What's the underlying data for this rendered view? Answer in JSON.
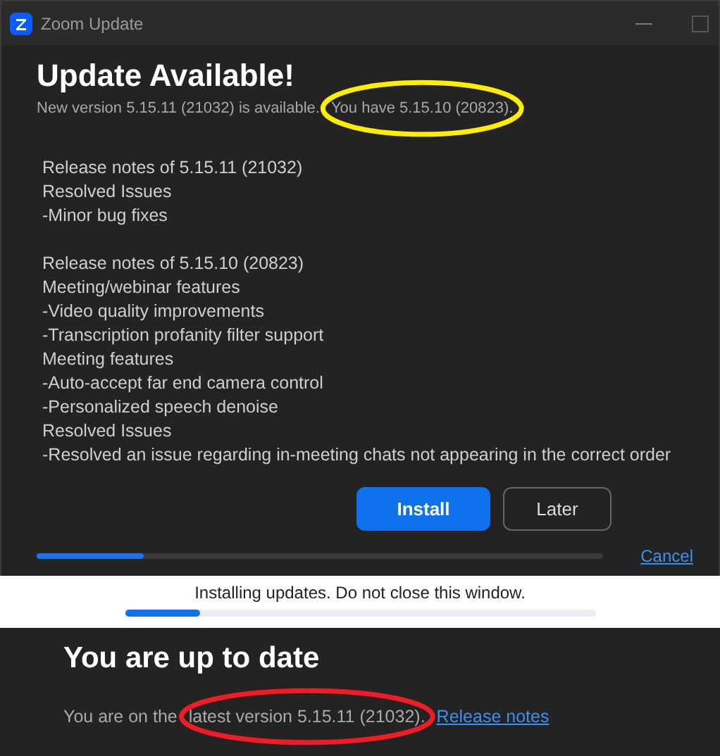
{
  "window": {
    "title": "Zoom Update"
  },
  "update": {
    "heading": "Update Available!",
    "subtitle": "New version 5.15.11 (21032) is available.",
    "installed": "You have 5.15.10 (20823).",
    "note_groups": [
      [
        "Release notes of 5.15.11 (21032)",
        "Resolved Issues",
        "-Minor bug fixes"
      ],
      [
        "Release notes of 5.15.10 (20823)",
        "Meeting/webinar features",
        "-Video quality improvements",
        "-Transcription profanity filter support",
        "Meeting features",
        "-Auto-accept far end camera control",
        "-Personalized speech denoise",
        "Resolved Issues",
        "-Resolved an issue regarding in-meeting chats not appearing in the correct order"
      ]
    ],
    "buttons": [
      {
        "label": "Install",
        "kind": "primary"
      },
      {
        "label": "Later",
        "kind": "secondary"
      }
    ],
    "progress": {
      "level": 0.19
    },
    "cancel": "Cancel"
  },
  "installing": {
    "message": "Installing updates. Do not close this window.",
    "progress": {
      "level": 0.16
    }
  },
  "up_to_date": {
    "heading": "You are up to date",
    "text": "You are on the",
    "version": "latest version 5.15.11 (21032).",
    "link": "Release notes"
  },
  "annotations": [
    {
      "kind": "ellipse",
      "color": "#ffee00"
    },
    {
      "kind": "ellipse",
      "color": "#ee1c25"
    }
  ]
}
